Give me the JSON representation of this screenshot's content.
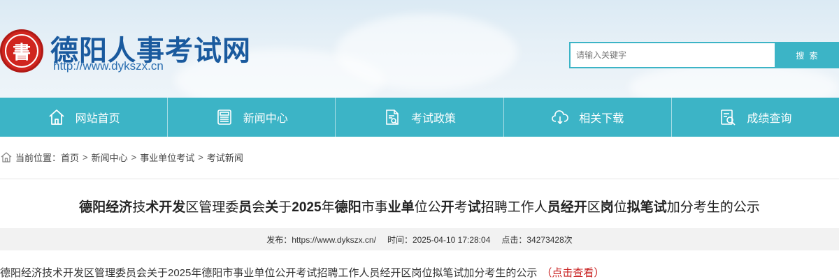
{
  "header": {
    "site_name": "德阳人事考试网",
    "site_url": "http://www.dykszx.cn",
    "logo_char": "書",
    "search_placeholder": "请输入关键字",
    "search_button": "搜 索"
  },
  "nav": {
    "items": [
      {
        "label": "网站首页",
        "icon": "home-icon"
      },
      {
        "label": "新闻中心",
        "icon": "news-icon"
      },
      {
        "label": "考试政策",
        "icon": "policy-icon"
      },
      {
        "label": "相关下载",
        "icon": "download-icon"
      },
      {
        "label": "成绩查询",
        "icon": "query-icon"
      }
    ]
  },
  "breadcrumb": {
    "prefix": "当前位置：",
    "items": [
      "首页",
      "新闻中心",
      "事业单位考试",
      "考试新闻"
    ]
  },
  "article": {
    "title_parts": [
      "德阳经济",
      "技",
      "术开发",
      "区管理委",
      "员",
      "会",
      "关",
      "于",
      "2025",
      "年",
      "德阳",
      "市事",
      "业单",
      "位公",
      "开",
      "考",
      "试",
      "招聘工作人",
      "员经开",
      "区",
      "岗",
      "位",
      "拟笔试",
      "加分考生的公示"
    ],
    "meta": {
      "publisher": "发布：https://www.dykszx.cn/",
      "time": "时间：2025-04-10 17:28:04",
      "clicks": "点击：34273428次"
    },
    "body_text": "德阳经济技术开发区管理委员会关于2025年德阳市事业单位公开考试招聘工作人员经开区岗位拟笔试加分考生的公示",
    "body_link": "（点击查看）"
  },
  "colors": {
    "accent": "#3cb4c6",
    "brand_blue": "#1a5a9e",
    "seal_red": "#d0251f",
    "link_red": "#c81e1e"
  }
}
